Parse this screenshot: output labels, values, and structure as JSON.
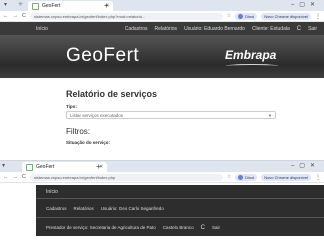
{
  "window1": {
    "tab_title": "GeoFert",
    "url": "sistemas.cnpso.embrapa.br/geofert/index.php?mod=relatorio...",
    "profile_label": "Dinoi",
    "update_label": "Novo Chrome disponível",
    "nav": {
      "inicio": "Início",
      "items": [
        "Cadastros",
        "Relatórios",
        "Usuário: Eduardo Bernardo",
        "Cliente: Estudala",
        "Sair"
      ]
    },
    "brand": "GeoFert",
    "partner_logo": "Embrapa",
    "page_title": "Relatório de serviços",
    "type_label": "Tipo:",
    "type_select_value": "Listar serviços executados",
    "filters_title": "Filtros:",
    "status_label": "Situação do serviço:"
  },
  "window2": {
    "tab_title": "GeoFert",
    "url": "sistemas.cnpso.embrapa.br/geofert/index.php",
    "profile_label": "Dinoi",
    "update_label": "Novo Chrome disponível",
    "inicio": "Início",
    "row1": [
      "Cadastros",
      "Relatórios",
      "Usuário: Geo Carlo Seganfredo"
    ],
    "row2": [
      "Prestador de serviço: Secretaria de Agricultura de Pato",
      "Castelo Branco",
      "Sair"
    ]
  },
  "icons": {
    "close": "✕",
    "new_tab": "+",
    "back": "←",
    "forward": "→",
    "reload": "C",
    "star": "☆",
    "kebab": "⋮",
    "caret": "▼",
    "refresh": "C",
    "menu": "▾"
  }
}
